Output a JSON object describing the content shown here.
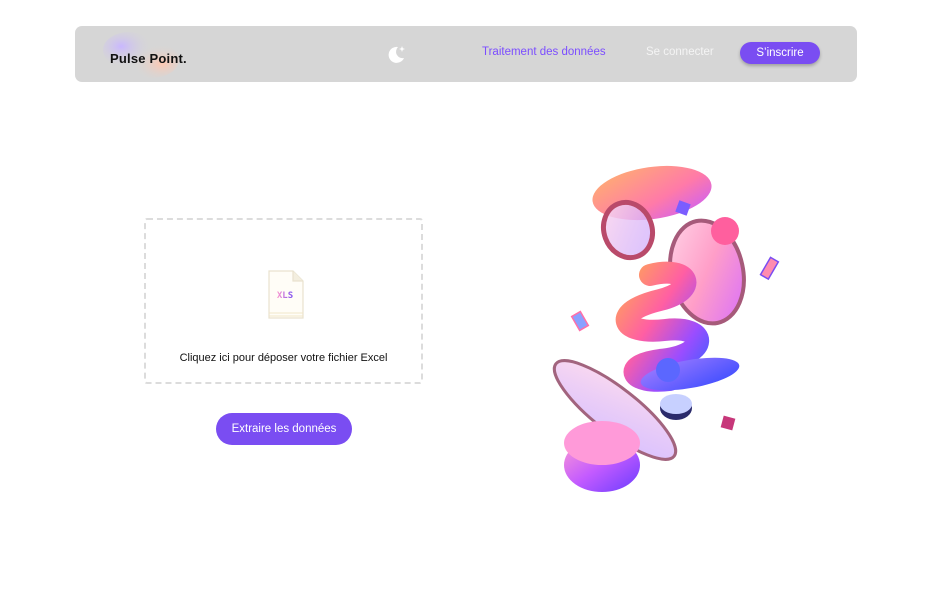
{
  "brand": {
    "name": "Pulse Point."
  },
  "nav": {
    "theme_toggle_icon": "moon-star-icon",
    "links": [
      {
        "label": "Traitement des données",
        "active": true
      },
      {
        "label": "Se connecter",
        "active": false
      }
    ],
    "signup_label": "S’inscrire"
  },
  "upload": {
    "file_icon": "xls-file-icon",
    "file_icon_text": "XLS",
    "instruction": "Cliquez ici pour déposer votre fichier Excel"
  },
  "actions": {
    "extract_label": "Extraire les données"
  },
  "colors": {
    "accent": "#7a4df2",
    "navbar_bg": "#d6d6d6",
    "dropzone_border": "#dcdcdc"
  }
}
